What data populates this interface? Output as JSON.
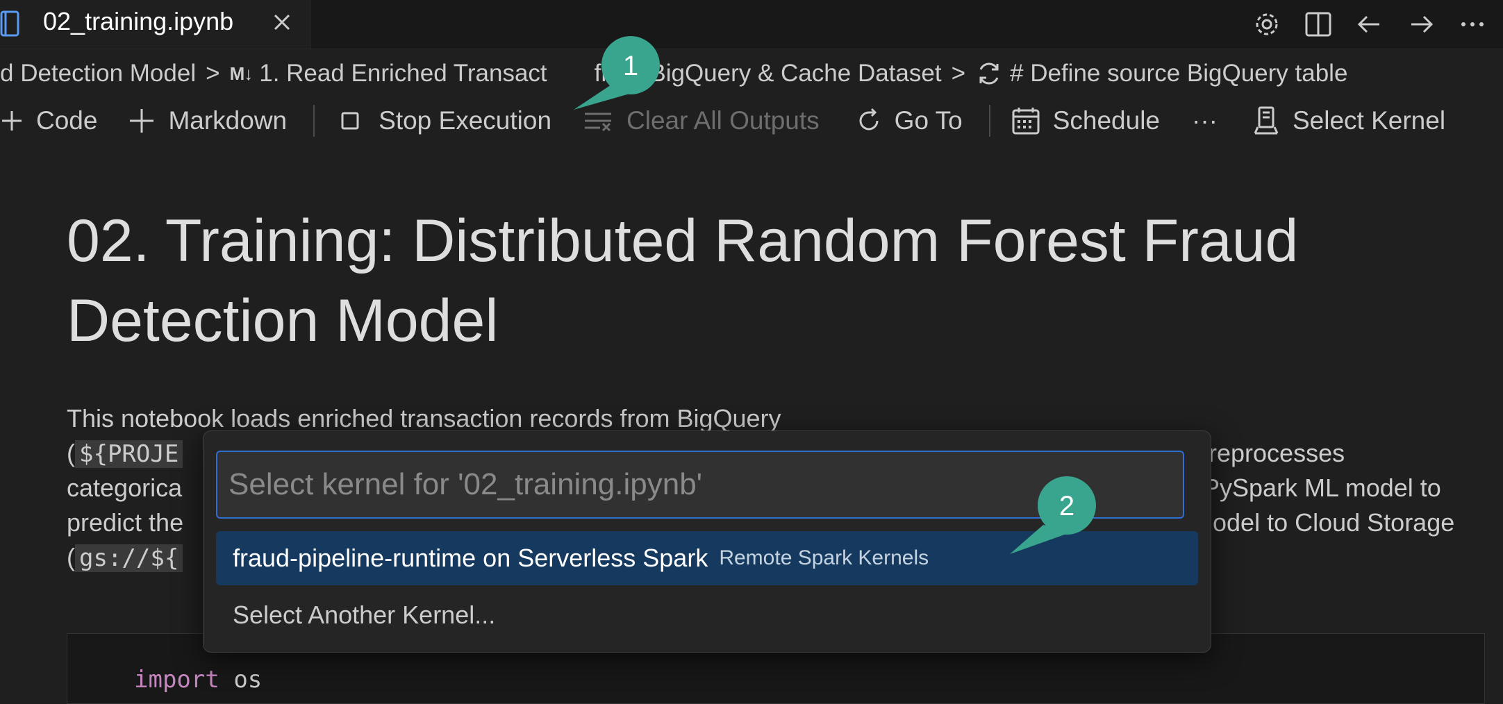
{
  "tab": {
    "title": "02_training.ipynb",
    "icon": "notebook-icon"
  },
  "breadcrumb": {
    "items": [
      {
        "label": "d Detection Model"
      },
      {
        "badge": "M↓",
        "label": "1. Read Enriched Transact"
      },
      {
        "label": "from BigQuery & Cache Dataset"
      },
      {
        "label": "# Define source BigQuery table"
      }
    ]
  },
  "toolbar": {
    "code": "Code",
    "markdown": "Markdown",
    "stop": "Stop Execution",
    "clear": "Clear All Outputs",
    "goto": "Go To",
    "schedule": "Schedule",
    "more": "···",
    "kernel": "Select Kernel"
  },
  "notebook": {
    "title": "02. Training: Distributed Random Forest Fraud Detection Model",
    "para_line1": "This notebook loads enriched transaction records from BigQuery",
    "para_line2_prefix": "(",
    "para_line2_code": "${PROJE",
    "para_line2_right": "reprocesses",
    "para_line3_left": "categorica",
    "para_line3_right": "PySpark ML model to",
    "para_line4_left": "predict the",
    "para_line4_right": "odel to Cloud Storage",
    "para_line5_prefix": "(",
    "para_line5_code": "gs://${",
    "code_keyword": "import",
    "code_rest": "os"
  },
  "quickpick": {
    "placeholder": "Select kernel for '02_training.ipynb'",
    "items": [
      {
        "label": "fraud-pipeline-runtime on Serverless Spark",
        "description": "Remote Spark Kernels"
      },
      {
        "label": "Select Another Kernel..."
      }
    ]
  },
  "callouts": [
    {
      "number": "1"
    },
    {
      "number": "2"
    }
  ],
  "colors": {
    "accent": "#2f6fd1",
    "callout": "#3aa58e",
    "selection": "#163a5f"
  }
}
